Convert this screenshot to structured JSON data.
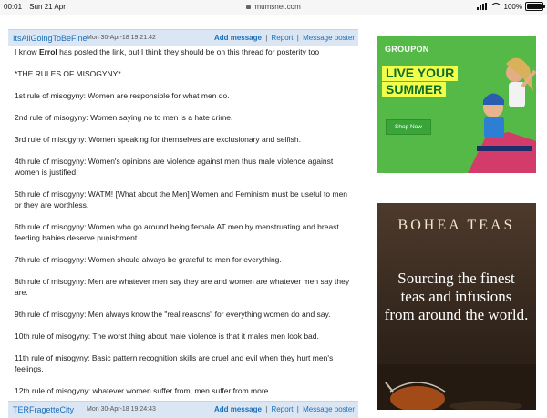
{
  "status_bar": {
    "time": "00:01",
    "date": "Sun 21 Apr",
    "url": "mumsnet.com",
    "battery": "100%"
  },
  "posts": [
    {
      "author": "ItsAllGoingToBeFine",
      "date": "Mon 30-Apr-18 19:21:42",
      "actions": {
        "add": "Add message",
        "report": "Report",
        "poster": "Message poster",
        "sep": "|"
      },
      "intro_before": "I know ",
      "intro_name": "Errol",
      "intro_after": " has posted the link, but I think they should be on this thread for posterity too",
      "heading": "*THE RULES OF MISOGYNY*",
      "rules": [
        "1st rule of misogyny: Women are responsible for what men do.",
        "2nd rule of misogyny: Women saying no to men is a hate crime.",
        "3rd rule of misogyny: Women speaking for themselves are exclusionary and selfish.",
        "4th rule of misogyny: Women's opinions are violence against men thus male violence against women is justified.",
        "5th rule of misogyny: WATM! [What about the Men] Women and Feminism must be useful to men or they are worthless.",
        "6th rule of misogyny: Women who go around being female AT men by menstruating and breast feeding babies deserve punishment.",
        "7th rule of misogyny: Women should always be grateful to men for everything.",
        "8th rule of misogyny: Men are whatever men say they are and women are whatever men say they are.",
        "9th rule of misogyny: Men always know the \"real reasons\" for everything women do and say.",
        "10th rule of misogyny: The worst thing about male violence is that it males men look bad.",
        "11th rule of misogyny: Basic pattern recognition skills are cruel and evil when they hurt men's feelings.",
        "12th rule of misogyny: whatever women suffer from, men suffer from more."
      ]
    },
    {
      "author": "TERFragetteCity",
      "date": "Mon 30-Apr-18 19:24:43",
      "actions": {
        "add": "Add message",
        "report": "Report",
        "poster": "Message poster",
        "sep": "|"
      }
    }
  ],
  "ads": {
    "groupon": {
      "brand": "GROUPON",
      "headline_1": "LIVE YOUR",
      "headline_2": "SUMMER",
      "button": "Shop Now",
      "bg_color": "#54b947",
      "accent_color": "#f2ff4a"
    },
    "bohea": {
      "brand": "BOHEA TEAS",
      "text": "Sourcing the finest teas and infusions from around the world."
    }
  },
  "colors": {
    "link": "#1b6fb8",
    "header_bg": "#dbe6f4"
  }
}
